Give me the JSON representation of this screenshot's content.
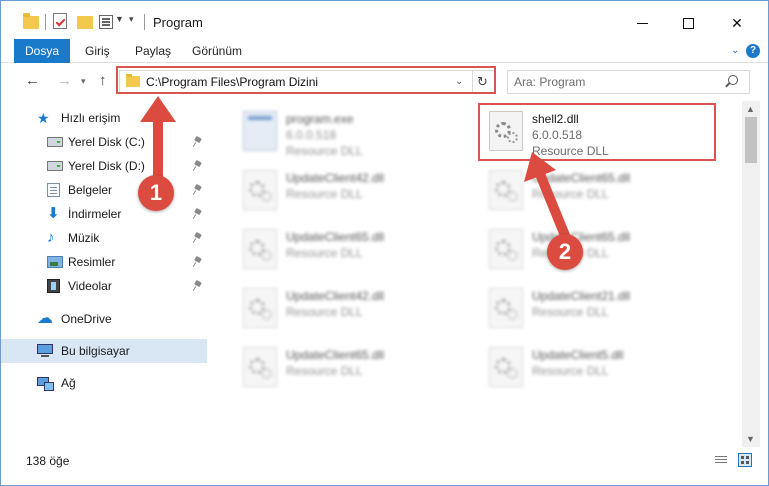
{
  "window": {
    "title": "Program"
  },
  "ribbon": {
    "tabs": [
      {
        "label": "Dosya"
      },
      {
        "label": "Giriş"
      },
      {
        "label": "Paylaş"
      },
      {
        "label": "Görünüm"
      }
    ]
  },
  "navigation": {
    "address": "C:\\Program Files\\Program Dizini",
    "search_placeholder": "Ara: Program"
  },
  "sidebar": {
    "quick_access": "Hızlı erişim",
    "items": [
      {
        "label": "Yerel Disk (C:)",
        "icon": "disk-icon",
        "pinned": true
      },
      {
        "label": "Yerel Disk (D:)",
        "icon": "disk-icon",
        "pinned": true
      },
      {
        "label": "Belgeler",
        "icon": "documents-icon",
        "pinned": true
      },
      {
        "label": "İndirmeler",
        "icon": "downloads-icon",
        "pinned": true
      },
      {
        "label": "Müzik",
        "icon": "music-icon",
        "pinned": true
      },
      {
        "label": "Resimler",
        "icon": "pictures-icon",
        "pinned": true
      },
      {
        "label": "Videolar",
        "icon": "videos-icon",
        "pinned": true
      }
    ],
    "onedrive": "OneDrive",
    "this_pc": "Bu bilgisayar",
    "network": "Ağ"
  },
  "files": [
    {
      "name": "program.exe",
      "version": "6.0.0.518",
      "type": "Resource DLL",
      "icon": "exe-icon",
      "blurred": true
    },
    {
      "name": "shell2.dll",
      "version": "6.0.0.518",
      "type": "Resource DLL",
      "icon": "dll-gear-icon",
      "blurred": false
    },
    {
      "name": "UpdateClient42.dll",
      "type": "Resource DLL",
      "icon": "dll-gear-icon",
      "blurred": true
    },
    {
      "name": "UpdateClient65.dll",
      "type": "Resource DLL",
      "icon": "dll-gear-icon",
      "blurred": true
    },
    {
      "name": "UpdateClient65.dll",
      "type": "Resource DLL",
      "icon": "dll-gear-icon",
      "blurred": true
    },
    {
      "name": "UpdateClient65.dll",
      "type": "Resource DLL",
      "icon": "dll-gear-icon",
      "blurred": true
    },
    {
      "name": "UpdateClient42.dll",
      "type": "Resource DLL",
      "icon": "dll-gear-icon",
      "blurred": true
    },
    {
      "name": "UpdateClient21.dll",
      "type": "Resource DLL",
      "icon": "dll-gear-icon",
      "blurred": true
    },
    {
      "name": "UpdateClient65.dll",
      "type": "Resource DLL",
      "icon": "dll-gear-icon",
      "blurred": true
    },
    {
      "name": "UpdateClient5.dll",
      "type": "Resource DLL",
      "icon": "dll-gear-icon",
      "blurred": true
    }
  ],
  "status": {
    "item_count": "138 öğe"
  },
  "annotations": {
    "step1": "1",
    "step2": "2",
    "color": "#dc4b3f"
  },
  "colors": {
    "accent": "#1979ca",
    "selection": "#d9e6f4",
    "highlight": "#d9534f"
  }
}
